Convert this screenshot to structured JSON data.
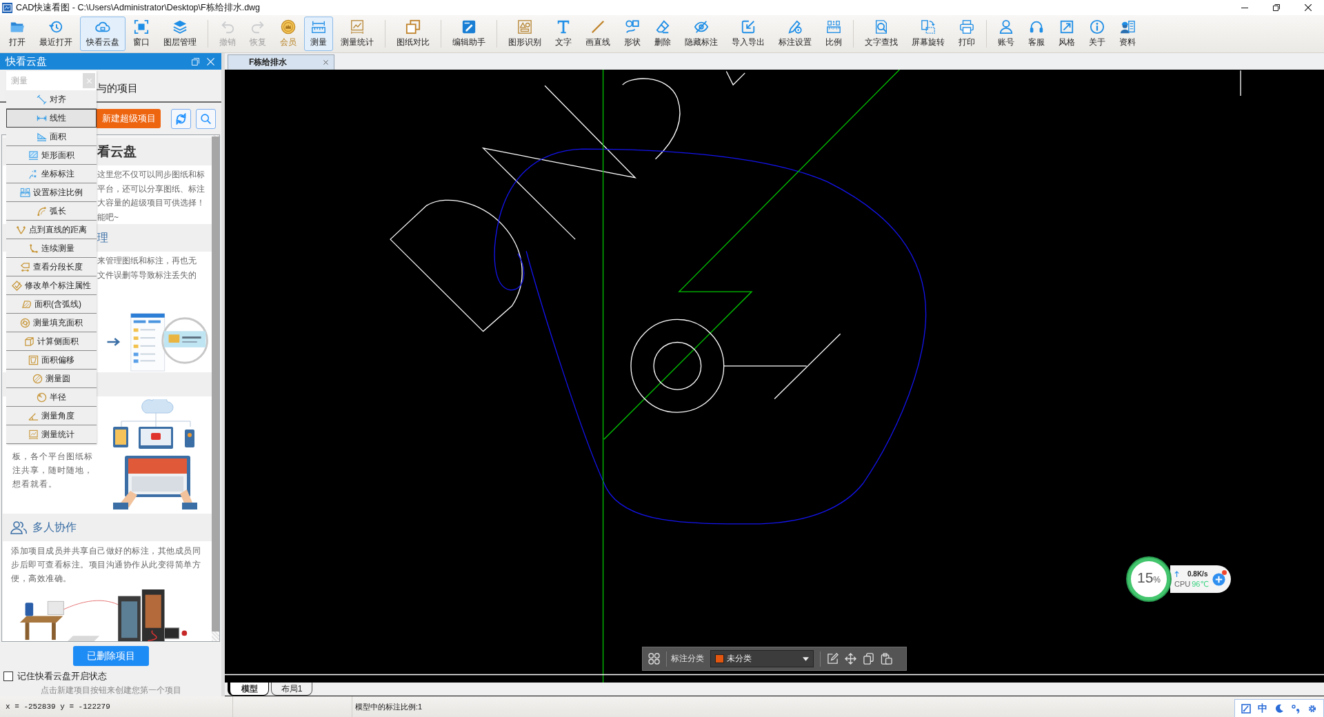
{
  "window": {
    "title": "CAD快速看图 - C:\\Users\\Administrator\\Desktop\\F栋给排水.dwg"
  },
  "toolbar": {
    "groups": [
      [
        {
          "label": "打开",
          "selected": false,
          "disabled": false
        },
        {
          "label": "最近打开",
          "selected": false,
          "disabled": false
        },
        {
          "label": "快看云盘",
          "selected": true,
          "disabled": false
        },
        {
          "label": "窗口",
          "selected": false,
          "disabled": false
        },
        {
          "label": "图层管理",
          "selected": false,
          "disabled": false
        }
      ],
      [
        {
          "label": "撤销",
          "selected": false,
          "disabled": true
        },
        {
          "label": "恢复",
          "selected": false,
          "disabled": true
        },
        {
          "label": "会员",
          "selected": false,
          "disabled": false
        },
        {
          "label": "测量",
          "selected": true,
          "disabled": false
        },
        {
          "label": "测量统计",
          "selected": false,
          "disabled": false
        }
      ],
      [
        {
          "label": "图纸对比",
          "selected": false,
          "disabled": false
        }
      ],
      [
        {
          "label": "编辑助手",
          "selected": false,
          "disabled": false
        }
      ],
      [
        {
          "label": "图形识别",
          "selected": false,
          "disabled": false
        },
        {
          "label": "文字",
          "selected": false,
          "disabled": false
        },
        {
          "label": "画直线",
          "selected": false,
          "disabled": false
        },
        {
          "label": "形状",
          "selected": false,
          "disabled": false
        },
        {
          "label": "删除",
          "selected": false,
          "disabled": false
        },
        {
          "label": "隐藏标注",
          "selected": false,
          "disabled": false
        },
        {
          "label": "导入导出",
          "selected": false,
          "disabled": false
        },
        {
          "label": "标注设置",
          "selected": false,
          "disabled": false
        },
        {
          "label": "比例",
          "selected": false,
          "disabled": false
        }
      ],
      [
        {
          "label": "文字查找",
          "selected": false,
          "disabled": false
        },
        {
          "label": "屏幕旋转",
          "selected": false,
          "disabled": false
        },
        {
          "label": "打印",
          "selected": false,
          "disabled": false
        }
      ],
      [
        {
          "label": "账号",
          "selected": false,
          "disabled": false
        },
        {
          "label": "客服",
          "selected": false,
          "disabled": false
        },
        {
          "label": "风格",
          "selected": false,
          "disabled": false
        },
        {
          "label": "关于",
          "selected": false,
          "disabled": false
        },
        {
          "label": "资料",
          "selected": false,
          "disabled": false
        }
      ]
    ]
  },
  "cloud_panel": {
    "title": "快看云盘",
    "project_tab": "与的项目",
    "new_super_project_button": "新建超级项目",
    "intro": {
      "heading": "看云盘",
      "lines": [
        "这里您不仅可以同步图纸和标",
        "平台，还可以分享图纸、标注",
        "大容量的超级项目可供选择！",
        "能吧~"
      ]
    },
    "manage": {
      "heading": "理",
      "lines": [
        "来管理图纸和标注，再也无",
        "文件误删等导致标注丢失的"
      ]
    },
    "share": {
      "text": "板，各个平台图纸标注共享，随时随地，想看就看。"
    },
    "collab": {
      "heading": "多人协作",
      "text": "添加项目成员并共享自己做好的标注，其他成员同步后即可查看标注。项目沟通协作从此变得简单方便，高效准确。"
    },
    "deleted_projects_button": "已删除项目",
    "remember": {
      "label": "记住快看云盘开启状态",
      "checked": false
    },
    "hint": "点击新建项目按钮来创建您第一个项目"
  },
  "measure_menu": {
    "title": "测量",
    "items": [
      {
        "label": "对齐",
        "selected": false
      },
      {
        "label": "线性",
        "selected": true
      },
      {
        "label": "面积",
        "selected": false
      },
      {
        "label": "矩形面积",
        "selected": false
      },
      {
        "label": "坐标标注",
        "selected": false
      },
      {
        "label": "设置标注比例",
        "selected": false
      },
      {
        "label": "弧长",
        "selected": false
      },
      {
        "label": "点到直线的距离",
        "selected": false
      },
      {
        "label": "连续测量",
        "selected": false
      },
      {
        "label": "查看分段长度",
        "selected": false
      },
      {
        "label": "修改单个标注属性",
        "selected": false
      },
      {
        "label": "面积(含弧线)",
        "selected": false
      },
      {
        "label": "测量填充面积",
        "selected": false
      },
      {
        "label": "计算侧面积",
        "selected": false
      },
      {
        "label": "面积偏移",
        "selected": false
      },
      {
        "label": "测量圆",
        "selected": false
      },
      {
        "label": "半径",
        "selected": false
      },
      {
        "label": "测量角度",
        "selected": false
      },
      {
        "label": "测量统计",
        "selected": false
      }
    ]
  },
  "document_tabs": [
    {
      "label": "F栋给排水",
      "selected": true
    }
  ],
  "annotation_bar": {
    "label": "标注分类",
    "category": {
      "value": "未分类",
      "color": "#e2560f"
    }
  },
  "speed_widget": {
    "load": "15",
    "unit": "%",
    "upload": "0.8K/s",
    "cpu_label": "CPU",
    "cpu_temp": "96℃"
  },
  "layout_tabs": [
    {
      "label": "模型",
      "selected": true
    },
    {
      "label": "布局1",
      "selected": false
    }
  ],
  "status_bar": {
    "coordinates": "x = -252839 y = -122279",
    "scale": "模型中的标注比例:1",
    "ime_mode": "中"
  }
}
